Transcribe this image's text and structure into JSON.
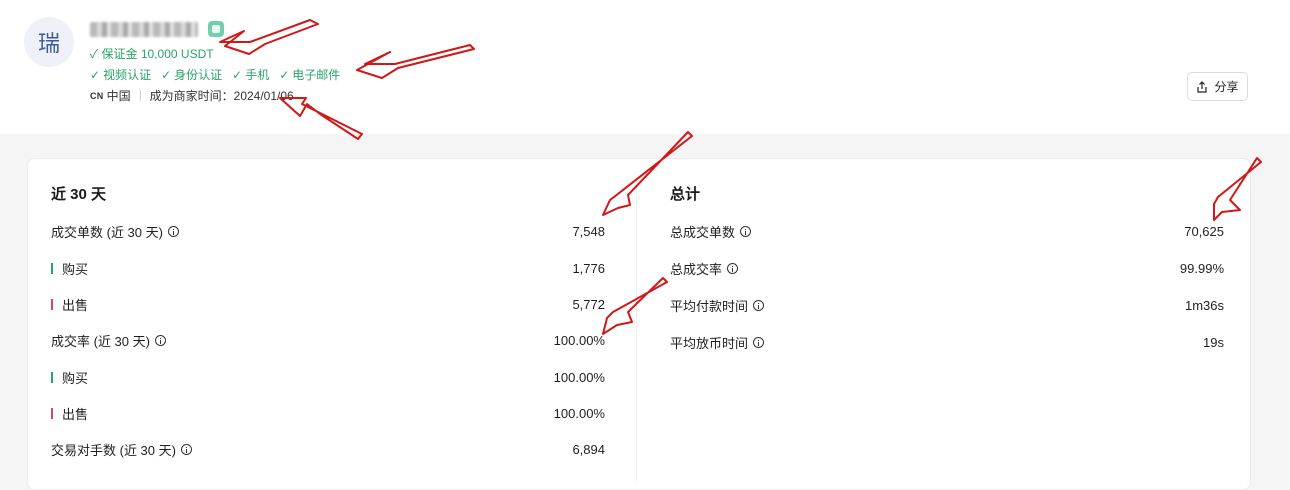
{
  "header": {
    "avatar_char": "瑞",
    "deposit_text": "✓ 保证金 10,000 USDT",
    "verifications": [
      "视频认证",
      "身份认证",
      "手机",
      "电子邮件"
    ],
    "country_code": "CN",
    "country_name": "中国",
    "merchant_since_label": "成为商家时间：",
    "merchant_since_date": "2024/01/06",
    "share_label": "分享"
  },
  "last30": {
    "title": "近 30 天",
    "rows": [
      {
        "label": "成交单数 (近 30 天)",
        "value": "7,548",
        "info": true,
        "bar": ""
      },
      {
        "label": "购买",
        "value": "1,776",
        "info": false,
        "bar": "buy"
      },
      {
        "label": "出售",
        "value": "5,772",
        "info": false,
        "bar": "sell"
      },
      {
        "label": "成交率 (近 30 天)",
        "value": "100.00%",
        "info": true,
        "bar": ""
      },
      {
        "label": "购买",
        "value": "100.00%",
        "info": false,
        "bar": "buy"
      },
      {
        "label": "出售",
        "value": "100.00%",
        "info": false,
        "bar": "sell"
      },
      {
        "label": "交易对手数 (近 30 天)",
        "value": "6,894",
        "info": true,
        "bar": ""
      }
    ]
  },
  "total": {
    "title": "总计",
    "rows": [
      {
        "label": "总成交单数",
        "value": "70,625",
        "info": true
      },
      {
        "label": "总成交率",
        "value": "99.99%",
        "info": true
      },
      {
        "label": "平均付款时间",
        "value": "1m36s",
        "info": true
      },
      {
        "label": "平均放币时间",
        "value": "19s",
        "info": true
      }
    ]
  },
  "colors": {
    "green": "#2aa36b",
    "sell_red": "#d9475a",
    "annotation_red": "#d01818"
  }
}
